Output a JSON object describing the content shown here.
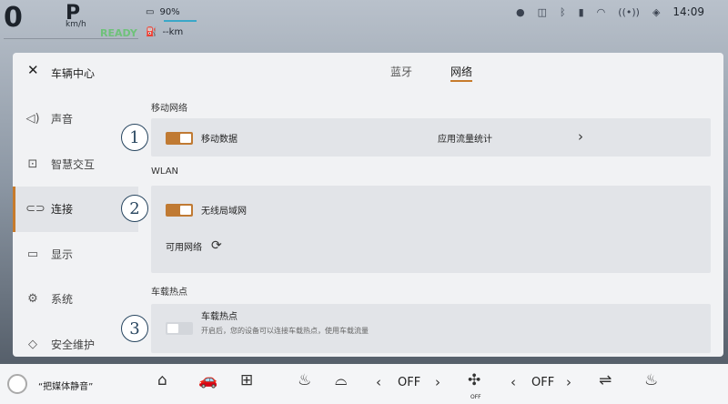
{
  "status_bar": {
    "speed": "0",
    "gear": "P",
    "speed_unit": "km/h",
    "ready": "READY",
    "battery_percent": "90%",
    "range": "--km",
    "time": "14:09",
    "icons": [
      "avatar-icon",
      "camera-icon",
      "bluetooth-icon",
      "signal-icon",
      "wifi-icon",
      "hotspot-icon",
      "shield-icon"
    ]
  },
  "panel": {
    "title": "车辆中心",
    "tabs": [
      {
        "label": "蓝牙"
      },
      {
        "label": "网络"
      }
    ],
    "active_tab": "网络"
  },
  "sidebar": {
    "items": [
      {
        "label": "声音",
        "icon": "speaker-icon"
      },
      {
        "label": "智慧交互",
        "icon": "interaction-icon"
      },
      {
        "label": "连接",
        "icon": "link-icon"
      },
      {
        "label": "显示",
        "icon": "display-icon"
      },
      {
        "label": "系统",
        "icon": "gear-icon"
      },
      {
        "label": "安全维护",
        "icon": "shield-icon"
      }
    ],
    "active": "连接"
  },
  "mobile": {
    "heading": "移动网络",
    "toggle_label": "移动数据",
    "toggle_on": true,
    "stats_label": "应用流量统计"
  },
  "wlan": {
    "heading": "WLAN",
    "toggle_label": "无线局域网",
    "toggle_on": true,
    "available_label": "可用网络"
  },
  "hotspot": {
    "heading": "车载热点",
    "toggle_label": "车载热点",
    "toggle_on": false,
    "description": "开启后，您的设备可以连接车载热点，使用车载流量"
  },
  "annotations": [
    "1",
    "2",
    "3"
  ],
  "dock": {
    "voice_hint": "“把媒体静音”",
    "left_fan": "OFF",
    "right_fan": "OFF",
    "fan_small": "OFF"
  },
  "colors": {
    "accent": "#c77b2c",
    "annotation": "#27455f"
  }
}
